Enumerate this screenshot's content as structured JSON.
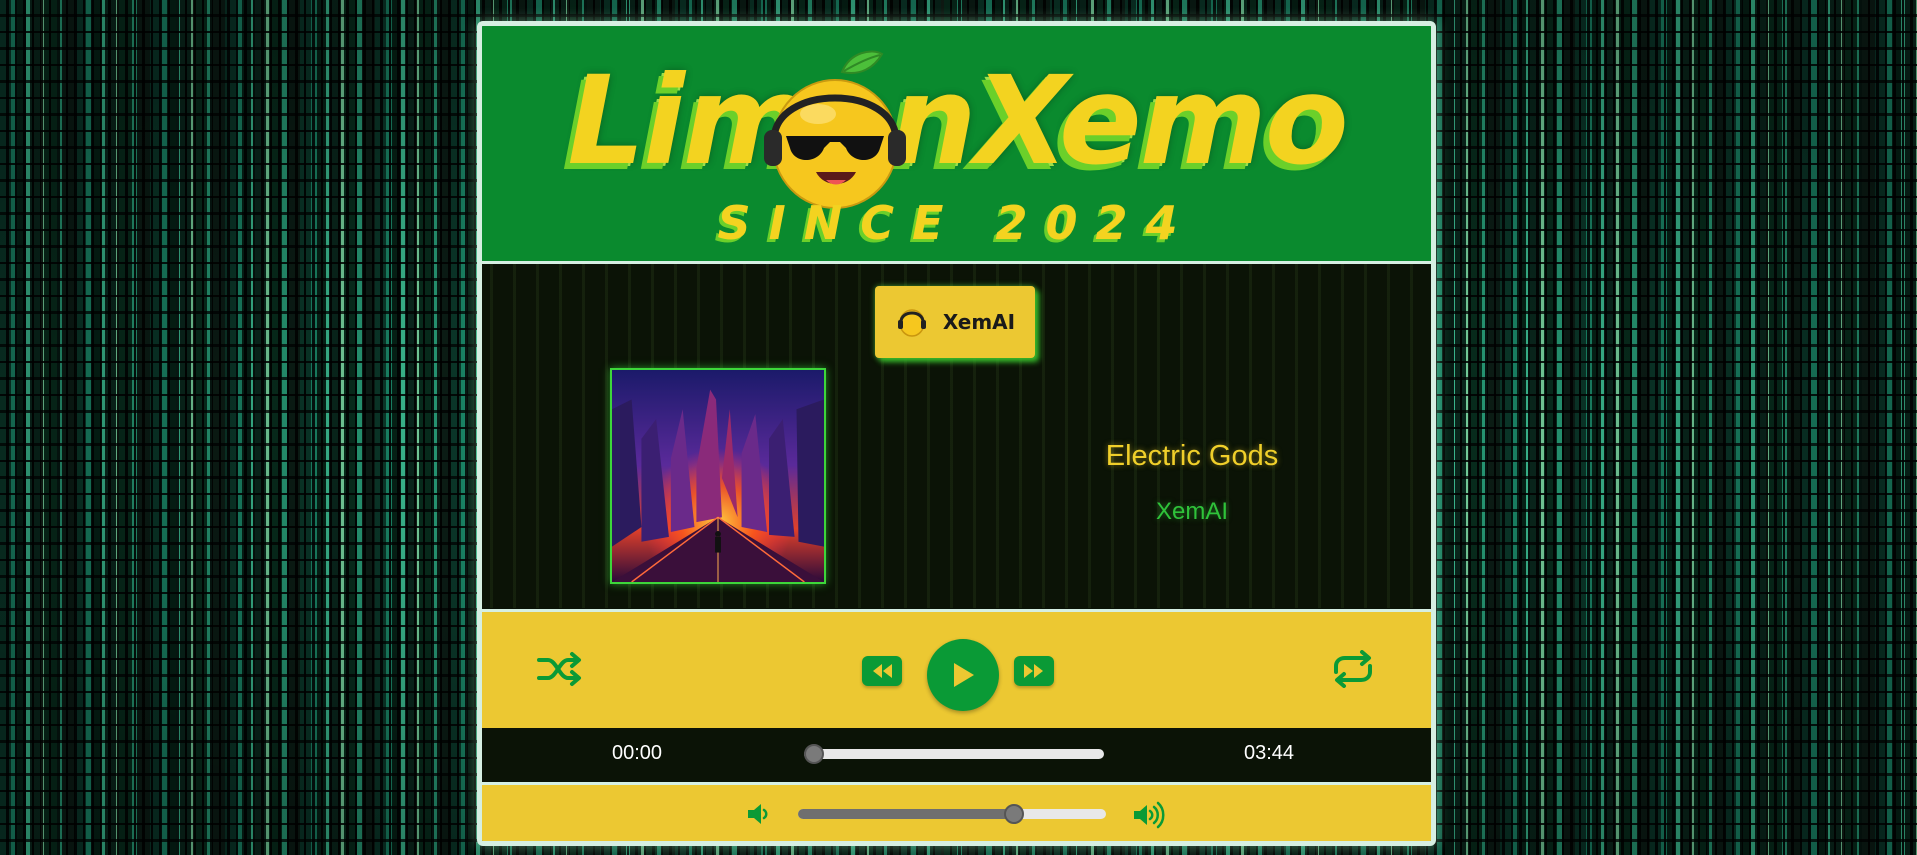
{
  "brand": {
    "logo_text": "LimonXemo",
    "since_text": "SINCE 2024"
  },
  "artist_button": {
    "label": "XemAI",
    "icon": "lemon-icon"
  },
  "track": {
    "title": "Electric Gods",
    "artist": "XemAI"
  },
  "controls": {
    "shuffle_icon": "shuffle-icon",
    "prev_icon": "rewind-icon",
    "play_icon": "play-icon",
    "next_icon": "fast-forward-icon",
    "repeat_icon": "repeat-icon"
  },
  "progress": {
    "current_time": "00:00",
    "total_time": "03:44",
    "fraction": 0.0
  },
  "volume": {
    "level": 0.7,
    "low_icon": "volume-low-icon",
    "high_icon": "volume-high-icon"
  },
  "colors": {
    "banner_green": "#0a8a2e",
    "accent_yellow": "#ecc832",
    "button_green": "#0a9a36",
    "title_yellow": "#f0cf2a",
    "artist_green": "#2fc23a"
  }
}
